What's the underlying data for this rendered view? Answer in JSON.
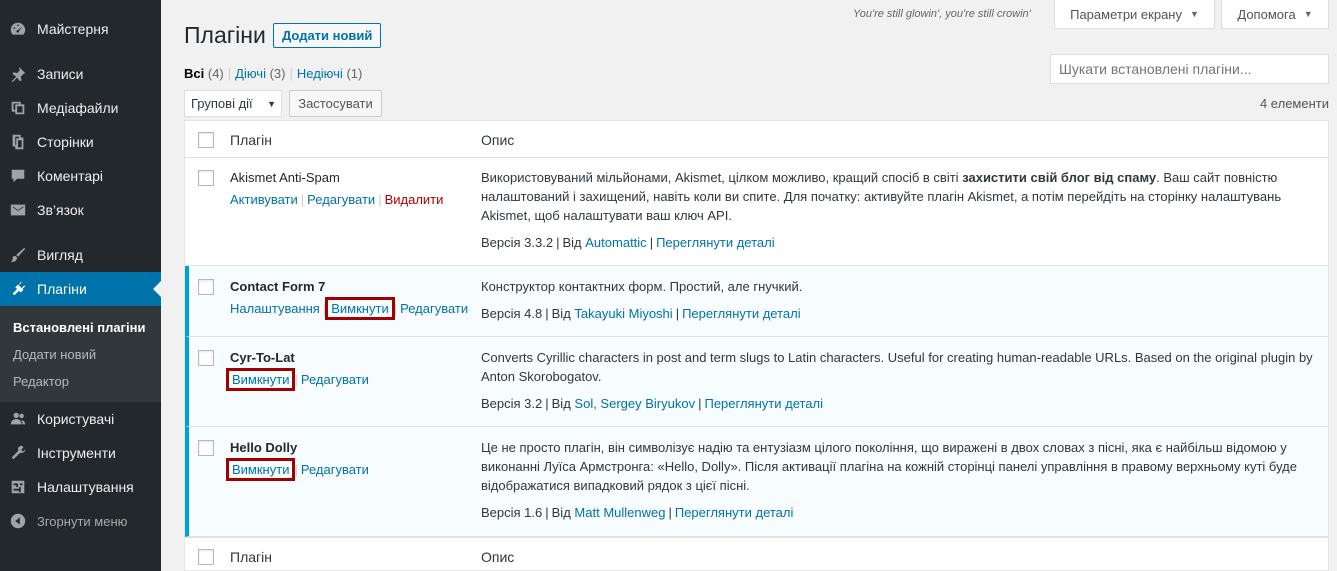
{
  "sidebar": {
    "items": [
      {
        "label": "Майстерня",
        "icon": "dashboard-icon"
      },
      {
        "label": "Записи",
        "icon": "pin-icon"
      },
      {
        "label": "Медіафайли",
        "icon": "media-icon"
      },
      {
        "label": "Сторінки",
        "icon": "pages-icon"
      },
      {
        "label": "Коментарі",
        "icon": "comments-icon"
      },
      {
        "label": "Зв’язок",
        "icon": "email-icon"
      },
      {
        "label": "Вигляд",
        "icon": "brush-icon"
      },
      {
        "label": "Плагіни",
        "icon": "plugin-icon",
        "active": true
      },
      {
        "label": "Користувачі",
        "icon": "users-icon"
      },
      {
        "label": "Інструменти",
        "icon": "tools-icon"
      },
      {
        "label": "Налаштування",
        "icon": "settings-icon"
      },
      {
        "label": "Згорнути меню",
        "icon": "collapse-icon"
      }
    ],
    "submenu": [
      "Встановлені плагіни",
      "Додати новий",
      "Редактор"
    ]
  },
  "header": {
    "title": "Плагіни",
    "add_new": "Додати новий",
    "dolly_line": "You're still glowin', you're still crowin'",
    "screen_options": "Параметри екрану",
    "help": "Допомога"
  },
  "filters": {
    "all": "Всі",
    "all_count": "(4)",
    "active": "Діючі",
    "active_count": "(3)",
    "inactive": "Недіючі",
    "inactive_count": "(1)"
  },
  "search": {
    "placeholder": "Шукати встановлені плагіни..."
  },
  "bulk": {
    "select": "Групові дії",
    "apply": "Застосувати",
    "count": "4 елементи"
  },
  "table": {
    "col_plugin": "Плагін",
    "col_desc": "Опис",
    "rows": [
      {
        "name": "Akismet Anti-Spam",
        "actions": [
          "Активувати",
          "Редагувати",
          "Видалити"
        ],
        "desc_pre": "Використовуваний мільйонами, Akismet, цілком можливо, кращий спосіб в світі ",
        "desc_bold": "захистити свій блог від спаму",
        "desc_post": ". Ваш сайт повністю налаштований і захищений, навіть коли ви спите. Для початку: активуйте плагін Akismet, а потім перейдіть на сторінку налаштувань Akismet, щоб налаштувати ваш ключ API.",
        "version": "Версія 3.3.2",
        "by": "Від",
        "author": "Automattic",
        "details": "Переглянути деталі"
      },
      {
        "name": "Contact Form 7",
        "actions": [
          "Налаштування",
          "Вимкнути",
          "Редагувати"
        ],
        "desc": "Конструктор контактних форм. Простий, але гнучкий.",
        "version": "Версія 4.8",
        "by": "Від",
        "author": "Takayuki Miyoshi",
        "details": "Переглянути деталі"
      },
      {
        "name": "Cyr-To-Lat",
        "actions": [
          "Вимкнути",
          "Редагувати"
        ],
        "desc": "Converts Cyrillic characters in post and term slugs to Latin characters. Useful for creating human-readable URLs. Based on the original plugin by Anton Skorobogatov.",
        "version": "Версія 3.2",
        "by": "Від",
        "author": "Sol, Sergey Biryukov",
        "details": "Переглянути деталі"
      },
      {
        "name": "Hello Dolly",
        "actions": [
          "Вимкнути",
          "Редагувати"
        ],
        "desc": "Це не просто плагін, він символізує надію та ентузіазм цілого покоління, що виражені в двох словах з пісні, яка є найбільш відомою у виконанні Луїса Армстронга: «Hello, Dolly». Після активації плагіна на кожній сторінці панелі управління в правому верхньому куті буде відображатися випадковий рядок з цієї пісні.",
        "version": "Версія 1.6",
        "by": "Від",
        "author": "Matt Mullenweg",
        "details": "Переглянути деталі"
      }
    ]
  }
}
